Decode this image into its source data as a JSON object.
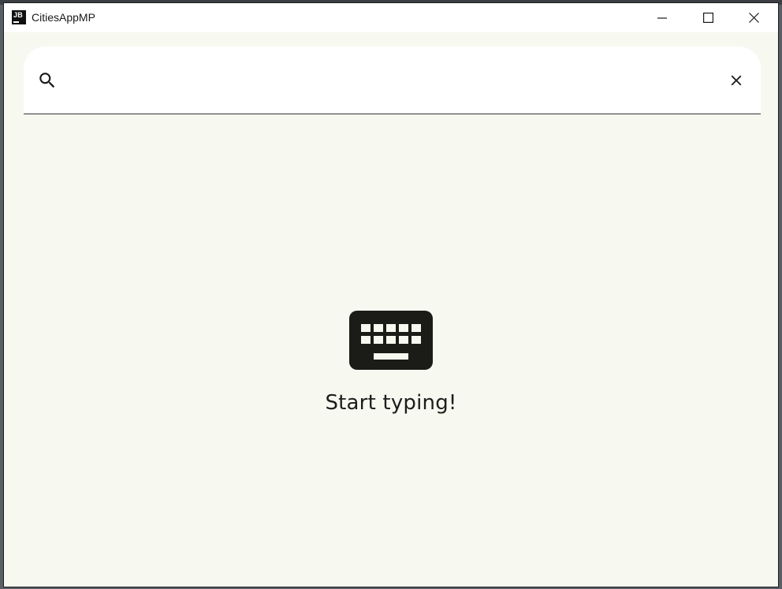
{
  "window": {
    "title": "CitiesAppMP",
    "app_icon_text": "JB",
    "controls": [
      "minimize",
      "maximize",
      "close"
    ]
  },
  "search": {
    "value": "",
    "placeholder": "",
    "leading_icon": "search-icon",
    "trailing_icon": "close-icon"
  },
  "empty_state": {
    "icon": "keyboard-icon",
    "message": "Start typing!"
  },
  "colors": {
    "background": "#f7f8ef",
    "surface": "#ffffff",
    "on_surface": "#1b1c17",
    "divider": "#333333"
  }
}
